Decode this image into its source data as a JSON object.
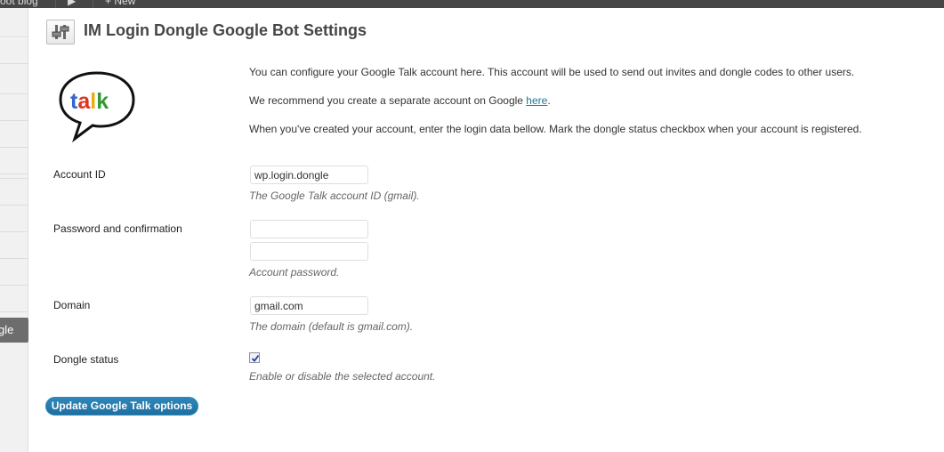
{
  "admin_bar": {
    "site_name": "oot blog",
    "new_label": "+ New"
  },
  "sidebar": {
    "current_item": "gle"
  },
  "page": {
    "title": "IM Login Dongle Google Bot Settings",
    "icon": "settings-sliders-icon"
  },
  "logo": {
    "name": "google-talk-logo",
    "text": "talk"
  },
  "intro": {
    "line1": "You can configure your Google Talk account here. This account will be used to send out invites and dongle codes to other users.",
    "line2_prefix": "We recommend you create a separate account on Google ",
    "line2_link": "here",
    "line2_suffix": ".",
    "line3": "When you've created your account, enter the login data bellow. Mark the dongle status checkbox when your account is registered."
  },
  "form": {
    "account_id": {
      "label": "Account ID",
      "value": "wp.login.dongle",
      "description": "The Google Talk account ID (gmail)."
    },
    "password": {
      "label": "Password and confirmation",
      "value": "",
      "confirm_value": "",
      "description": "Account password."
    },
    "domain": {
      "label": "Domain",
      "value": "gmail.com",
      "description": "The domain (default is gmail.com)."
    },
    "dongle_status": {
      "label": "Dongle status",
      "checked": true,
      "description": "Enable or disable the selected account."
    },
    "submit_label": "Update Google Talk options"
  },
  "colors": {
    "admin_bar": "#464646",
    "link": "#21759b",
    "button": "#21759b"
  }
}
